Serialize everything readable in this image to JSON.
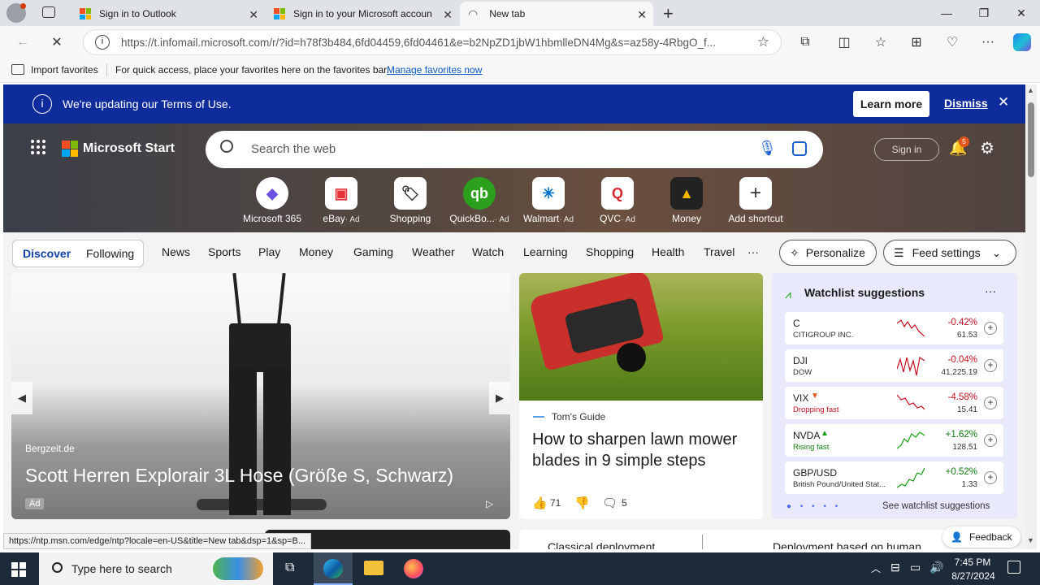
{
  "browser": {
    "tabs": [
      {
        "title": "Sign in to Outlook",
        "active": false
      },
      {
        "title": "Sign in to your Microsoft accoun",
        "active": false
      },
      {
        "title": "New tab",
        "active": true
      }
    ],
    "url": "https://t.infomail.microsoft.com/r/?id=h78f3b484,6fd04459,6fd04461&e=b2NpZD1jbW1hbmlleDN4Mg&s=az58y-4RbgO_f...",
    "favorites_bar": {
      "import_label": "Import favorites",
      "hint": "For quick access, place your favorites here on the favorites bar.",
      "manage_link": "Manage favorites now"
    },
    "status_url": "https://ntp.msn.com/edge/ntp?locale=en-US&title=New tab&dsp=1&sp=B..."
  },
  "banner": {
    "message": "We're updating our Terms of Use.",
    "learn_more": "Learn more",
    "dismiss": "Dismiss",
    "bg_color": "#0f2c9c"
  },
  "header": {
    "brand": "Microsoft Start",
    "search_placeholder": "Search the web",
    "sign_in": "Sign in",
    "notification_count": "5"
  },
  "shortcuts": [
    {
      "label": "Microsoft 365",
      "ad": "",
      "icon": "m365-icon",
      "color": "#6b4fe0"
    },
    {
      "label": "eBay",
      "ad": "· Ad",
      "icon": "ebay-icon",
      "color": "#e53238"
    },
    {
      "label": "Shopping",
      "ad": "",
      "icon": "tag-icon",
      "color": "#333333"
    },
    {
      "label": "QuickBo...",
      "ad": "· Ad",
      "icon": "quickbooks-icon",
      "color": "#2ca01c"
    },
    {
      "label": "Walmart",
      "ad": "· Ad",
      "icon": "walmart-icon",
      "color": "#0071ce"
    },
    {
      "label": "QVC",
      "ad": "· Ad",
      "icon": "qvc-icon",
      "color": "#d7282f"
    },
    {
      "label": "Money",
      "ad": "",
      "icon": "money-icon",
      "color": "#222222"
    },
    {
      "label": "Add shortcut",
      "ad": "",
      "icon": "plus-icon",
      "color": "#333333"
    }
  ],
  "feed_nav": {
    "discover": "Discover",
    "following": "Following",
    "items": [
      "News",
      "Sports",
      "Play",
      "Money",
      "Gaming",
      "Weather",
      "Watch",
      "Learning",
      "Shopping",
      "Health",
      "Travel"
    ],
    "more": "···",
    "personalize": "Personalize",
    "feed_settings": "Feed settings"
  },
  "main_card": {
    "source": "Bergzeit.de",
    "title": "Scott Herren Explorair 3L Hose (Größe S, Schwarz)",
    "ad_badge": "Ad"
  },
  "mower_card": {
    "source": "Tom's Guide",
    "title": "How to sharpen lawn mower blades in 9 simple steps",
    "likes": "71",
    "comments": "5"
  },
  "watchlist": {
    "title": "Watchlist suggestions",
    "more": "···",
    "footer": "See watchlist suggestions",
    "rows": [
      {
        "symbol": "C",
        "name": "CITIGROUP INC.",
        "change": "-0.42%",
        "price": "61.53",
        "dir": "down"
      },
      {
        "symbol": "DJI",
        "name": "DOW",
        "change": "-0.04%",
        "price": "41,225.19",
        "dir": "down"
      },
      {
        "symbol": "VIX",
        "name": "Dropping fast",
        "change": "-4.58%",
        "price": "15.41",
        "dir": "down"
      },
      {
        "symbol": "NVDA",
        "name": "Rising fast",
        "change": "+1.62%",
        "price": "128.51",
        "dir": "up"
      },
      {
        "symbol": "GBP/USD",
        "name": "British Pound/United Stat...",
        "change": "+0.52%",
        "price": "1.33",
        "dir": "up"
      }
    ]
  },
  "below": {
    "left_title": "Classical deployment",
    "right_title": "Deployment based on human ..."
  },
  "feedback": "Feedback",
  "taskbar": {
    "search_placeholder": "Type here to search",
    "time": "7:45 PM",
    "date": "8/27/2024"
  }
}
